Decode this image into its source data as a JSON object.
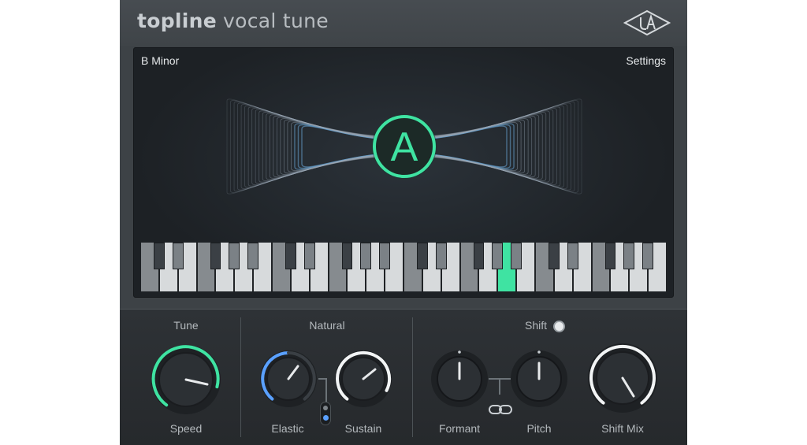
{
  "app": {
    "brand_bold": "topline",
    "brand_light": "vocal tune",
    "logo_icon": "ua-diamond-logo-icon"
  },
  "display": {
    "key": "B Minor",
    "settings_label": "Settings",
    "detected_note": "A",
    "accent_color": "#3fe3a2"
  },
  "keyboard": {
    "active_key_color": "#3fe3a2"
  },
  "sections": {
    "tune": {
      "title": "Tune",
      "speed_label": "Speed"
    },
    "natural": {
      "title": "Natural",
      "elastic_label": "Elastic",
      "sustain_label": "Sustain",
      "switch_icon": "two-dot-switch-icon"
    },
    "shift": {
      "title": "Shift",
      "formant_label": "Formant",
      "pitch_label": "Pitch",
      "mix_label": "Shift Mix",
      "link_icon": "link-chain-icon"
    }
  },
  "colors": {
    "tune_ring": "#3fe3a2",
    "elastic_ring": "#5aa0ff",
    "white_ring": "#f2f4f5"
  }
}
